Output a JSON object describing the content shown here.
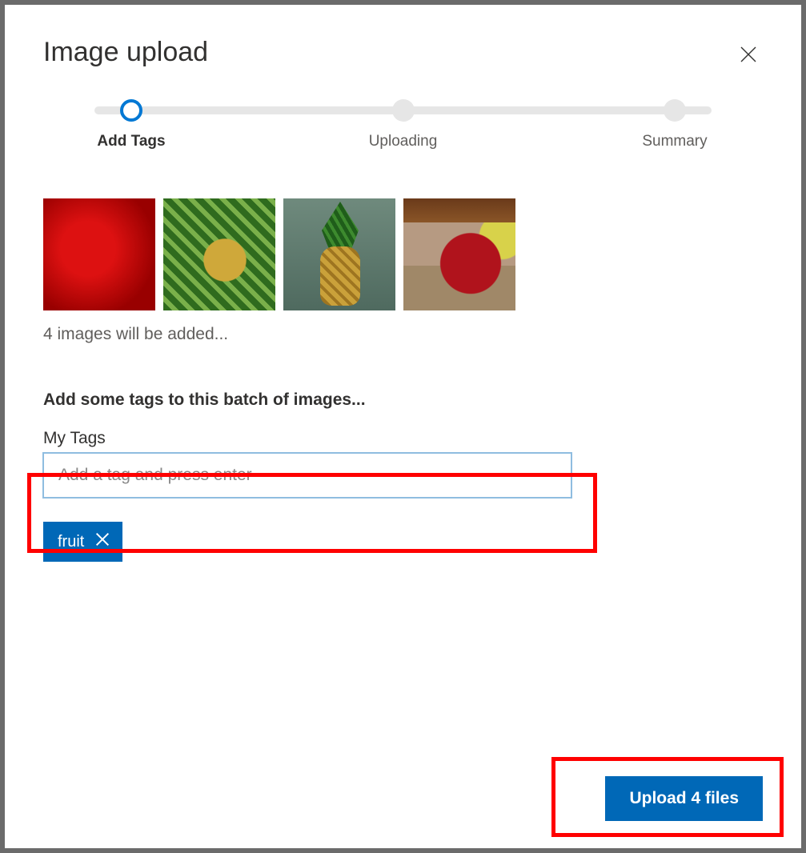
{
  "header": {
    "title": "Image upload"
  },
  "stepper": {
    "steps": [
      {
        "label": "Add Tags",
        "active": true
      },
      {
        "label": "Uploading",
        "active": false
      },
      {
        "label": "Summary",
        "active": false
      }
    ]
  },
  "thumbnails": {
    "count": 4,
    "items": [
      {
        "name": "thumb-strawberries"
      },
      {
        "name": "thumb-pineapple-crown"
      },
      {
        "name": "thumb-pineapple-whole"
      },
      {
        "name": "thumb-apple"
      }
    ],
    "status_text": "4 images will be added..."
  },
  "tags": {
    "heading": "Add some tags to this batch of images...",
    "label": "My Tags",
    "input_placeholder": "Add a tag and press enter",
    "chips": [
      {
        "label": "fruit"
      }
    ]
  },
  "footer": {
    "upload_label": "Upload 4 files"
  }
}
